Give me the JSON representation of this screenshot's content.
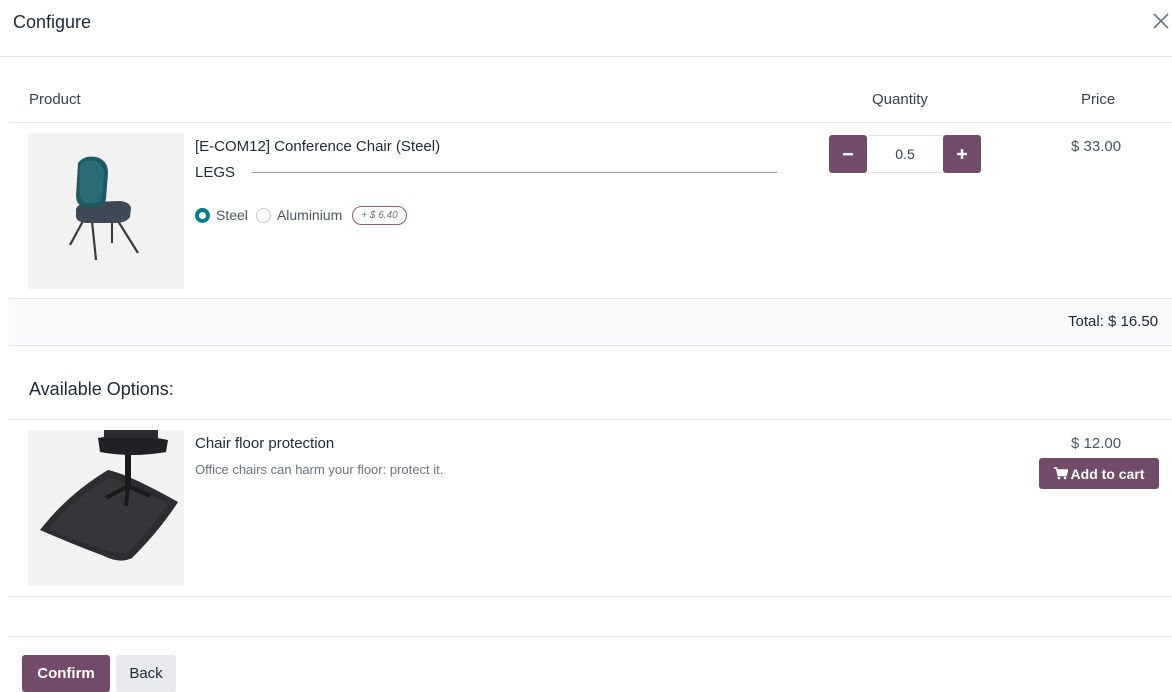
{
  "dialog": {
    "title": "Configure",
    "close_icon": "close-icon"
  },
  "table_header": {
    "product": "Product",
    "quantity": "Quantity",
    "price": "Price"
  },
  "main_product": {
    "name": "[E-COM12] Conference Chair (Steel)",
    "image_icon": "chair-image",
    "attribute": {
      "label": "LEGS",
      "options": [
        {
          "label": "Steel",
          "selected": true
        },
        {
          "label": "Aluminium",
          "selected": false,
          "extra_price": "+ $ 6.40"
        }
      ]
    },
    "quantity": "0.5",
    "minus_icon": "minus-icon",
    "plus_icon": "plus-icon",
    "price": "$ 33.00"
  },
  "total": {
    "label": "Total: $ 16.50"
  },
  "available_options": {
    "title": "Available Options:",
    "items": [
      {
        "name": "Chair floor protection",
        "description": "Office chairs can harm your floor: protect it.",
        "price": "$ 12.00",
        "image_icon": "floor-mat-image",
        "button_label": "Add to cart",
        "button_icon": "cart-icon"
      }
    ]
  },
  "footer": {
    "confirm_label": "Confirm",
    "back_label": "Back"
  },
  "colors": {
    "primary": "#714b67",
    "radio_accent": "#017e84",
    "chair_seat": "#1f5a63"
  }
}
